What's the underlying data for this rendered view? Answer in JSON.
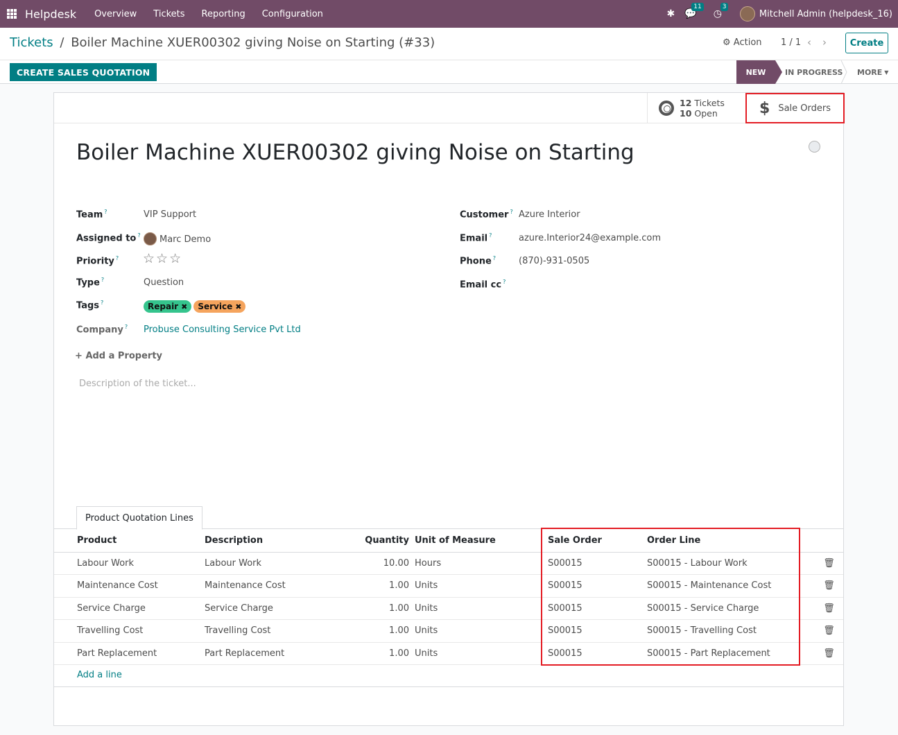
{
  "navbar": {
    "app_name": "Helpdesk",
    "menu": [
      "Overview",
      "Tickets",
      "Reporting",
      "Configuration"
    ],
    "messages_count": "11",
    "activities_count": "3",
    "user_name": "Mitchell Admin (helpdesk_16)"
  },
  "control_panel": {
    "breadcrumb_parent": "Tickets",
    "breadcrumb_separator": "/",
    "breadcrumb_current": "Boiler Machine XUER00302 giving Noise on Starting (#33)",
    "action_label": "Action",
    "pager": "1 / 1",
    "create_label": "Create"
  },
  "status_bar": {
    "quotation_button": "CREATE SALES QUOTATION",
    "stages": [
      "NEW",
      "IN PROGRESS"
    ],
    "active_stage": "NEW",
    "more_label": "MORE"
  },
  "smart_buttons": {
    "tickets_count": "12",
    "tickets_label": "Tickets",
    "open_count": "10",
    "open_label": "Open",
    "sale_orders_label": "Sale Orders"
  },
  "ticket": {
    "title": "Boiler Machine XUER00302 giving Noise on Starting",
    "labels": {
      "team": "Team",
      "assigned_to": "Assigned to",
      "priority": "Priority",
      "type": "Type",
      "tags": "Tags",
      "company": "Company",
      "customer": "Customer",
      "email": "Email",
      "phone": "Phone",
      "email_cc": "Email cc"
    },
    "team": "VIP Support",
    "assigned_to": "Marc Demo",
    "priority_stars": "☆☆☆",
    "type": "Question",
    "tags": [
      {
        "label": "Repair",
        "color": "#35c48d"
      },
      {
        "label": "Service",
        "color": "#f5a45d"
      }
    ],
    "company": "Probuse Consulting Service Pvt Ltd",
    "customer": "Azure Interior",
    "email": "azure.Interior24@example.com",
    "phone": "(870)-931-0505",
    "email_cc": "",
    "add_property_label": "Add a Property",
    "description_placeholder": "Description of the ticket..."
  },
  "quotation_lines": {
    "tab_label": "Product Quotation Lines",
    "columns": [
      "Product",
      "Description",
      "Quantity",
      "Unit of Measure",
      "Sale Order",
      "Order Line"
    ],
    "rows": [
      {
        "product": "Labour Work",
        "description": "Labour Work",
        "quantity": "10.00",
        "uom": "Hours",
        "sale_order": "S00015",
        "order_line": "S00015 - Labour Work"
      },
      {
        "product": "Maintenance Cost",
        "description": "Maintenance Cost",
        "quantity": "1.00",
        "uom": "Units",
        "sale_order": "S00015",
        "order_line": "S00015 - Maintenance Cost"
      },
      {
        "product": "Service Charge",
        "description": "Service Charge",
        "quantity": "1.00",
        "uom": "Units",
        "sale_order": "S00015",
        "order_line": "S00015 - Service Charge"
      },
      {
        "product": "Travelling Cost",
        "description": "Travelling Cost",
        "quantity": "1.00",
        "uom": "Units",
        "sale_order": "S00015",
        "order_line": "S00015 - Travelling Cost"
      },
      {
        "product": "Part Replacement",
        "description": "Part Replacement",
        "quantity": "1.00",
        "uom": "Units",
        "sale_order": "S00015",
        "order_line": "S00015 - Part Replacement"
      }
    ],
    "add_line_label": "Add a line"
  },
  "colors": {
    "brand": "#714b67",
    "accent": "#017e84",
    "highlight": "#e31b23"
  }
}
